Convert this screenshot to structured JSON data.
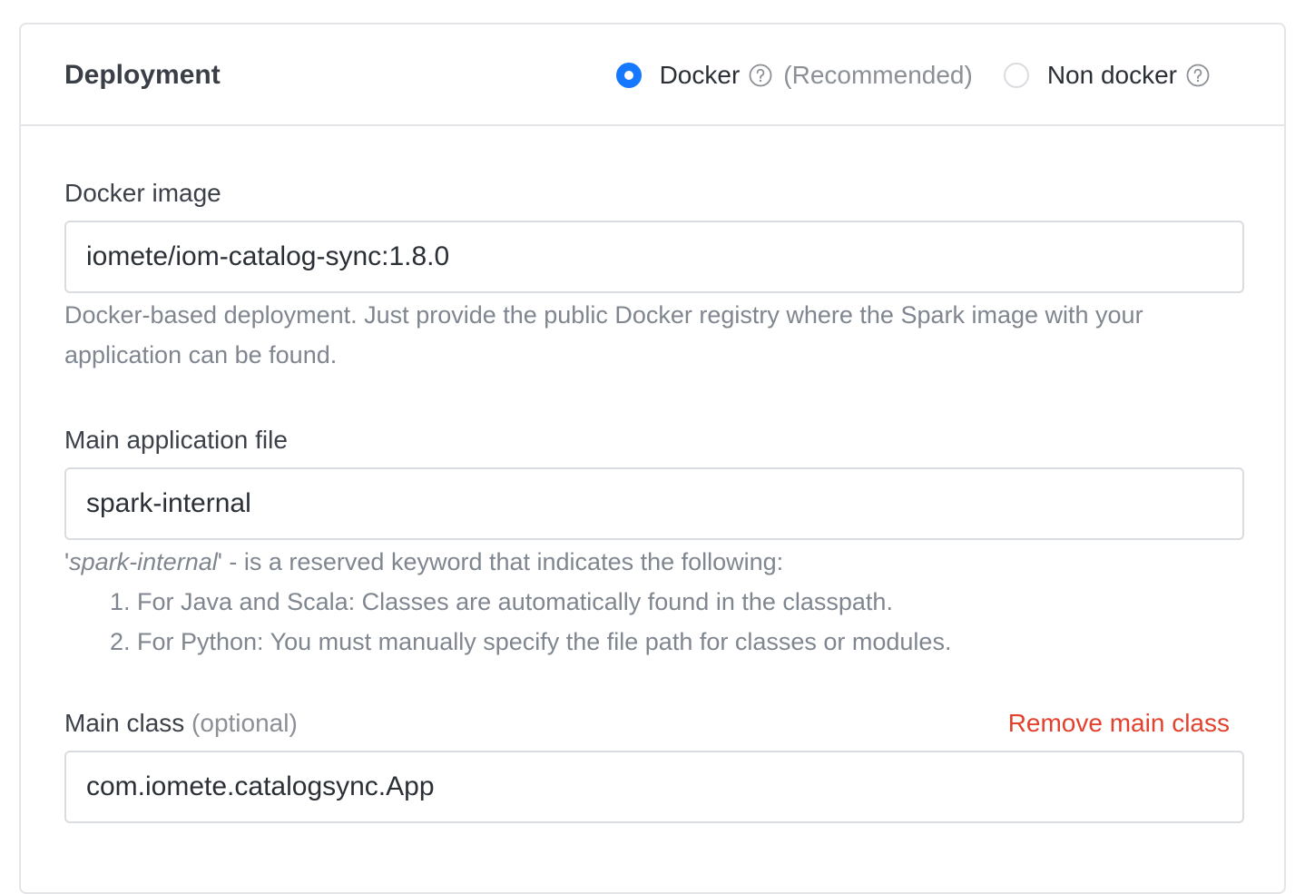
{
  "section": {
    "title": "Deployment"
  },
  "deployment_mode": {
    "options": [
      {
        "label": "Docker",
        "checked": true,
        "note": "(Recommended)"
      },
      {
        "label": "Non docker",
        "checked": false
      }
    ]
  },
  "docker_image": {
    "label": "Docker image",
    "value": "iomete/iom-catalog-sync:1.8.0",
    "help": "Docker-based deployment. Just provide the public Docker registry where the Spark image with your application can be found."
  },
  "main_app_file": {
    "label": "Main application file",
    "value": "spark-internal",
    "help_quote_open": "'",
    "help_keyword": "spark-internal",
    "help_rest": "' - is a reserved keyword that indicates the following:",
    "help_items": [
      "For Java and Scala: Classes are automatically found in the classpath.",
      "For Python: You must manually specify the file path for classes or modules."
    ]
  },
  "main_class": {
    "label": "Main class",
    "optional": "(optional)",
    "remove_label": "Remove main class",
    "value": "com.iomete.catalogsync.App"
  },
  "colors": {
    "accent": "#1677ff",
    "danger": "#e3412e",
    "muted": "#7f868f",
    "border": "#e3e5e8"
  },
  "icons": {
    "help": "question-circle-icon"
  }
}
